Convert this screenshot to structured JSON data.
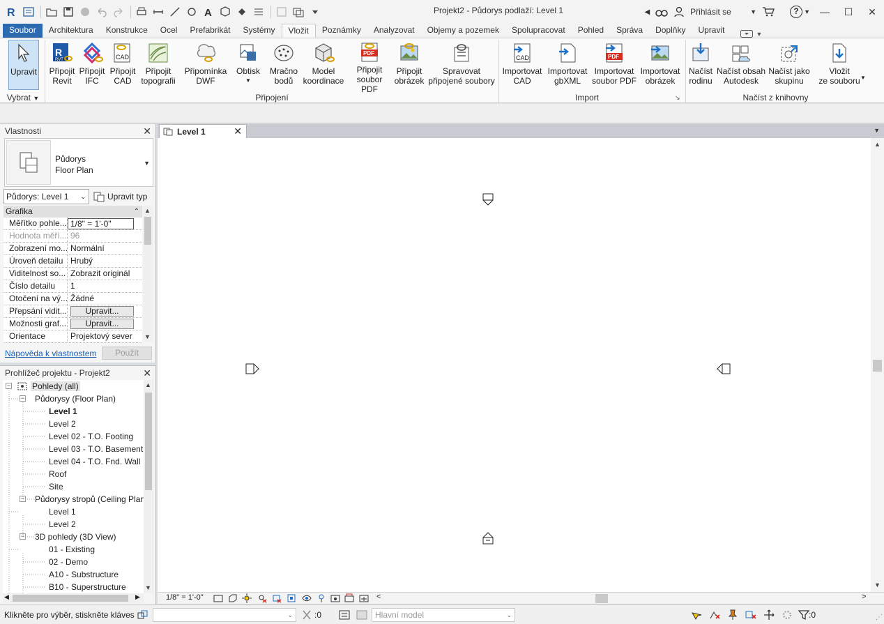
{
  "window": {
    "title": "Projekt2 - Půdorys podlaží: Level 1",
    "sign_in": "Přihlásit se",
    "help": "?"
  },
  "ribbon_tabs": [
    {
      "label": "Soubor"
    },
    {
      "label": "Architektura"
    },
    {
      "label": "Konstrukce"
    },
    {
      "label": "Ocel"
    },
    {
      "label": "Prefabrikát"
    },
    {
      "label": "Systémy"
    },
    {
      "label": "Vložit"
    },
    {
      "label": "Poznámky"
    },
    {
      "label": "Analyzovat"
    },
    {
      "label": "Objemy a pozemek"
    },
    {
      "label": "Spolupracovat"
    },
    {
      "label": "Pohled"
    },
    {
      "label": "Správa"
    },
    {
      "label": "Doplňky"
    },
    {
      "label": "Upravit"
    }
  ],
  "active_tab": "Vložit",
  "ribbon": {
    "select": {
      "label": "Upravit",
      "group": "Vybrat"
    },
    "link_buttons": [
      {
        "line1": "Připojit",
        "line2": "Revit",
        "icon": "link-revit-icon"
      },
      {
        "line1": "Připojit",
        "line2": "IFC",
        "icon": "link-ifc-icon"
      },
      {
        "line1": "Připojit",
        "line2": "CAD",
        "icon": "link-cad-icon"
      },
      {
        "line1": "Připojit",
        "line2": "topografii",
        "icon": "link-topography-icon"
      },
      {
        "line1": "Připomínka",
        "line2": "DWF",
        "icon": "dwf-markup-icon"
      },
      {
        "line1": "Obtisk",
        "line2": "",
        "icon": "decal-icon"
      },
      {
        "line1": "Mračno",
        "line2": "bodů",
        "icon": "point-cloud-icon"
      },
      {
        "line1": "Model",
        "line2": "koordinace",
        "icon": "coordination-model-icon"
      },
      {
        "line1": "Připojit",
        "line2": "soubor PDF",
        "icon": "link-pdf-icon"
      },
      {
        "line1": "Připojit",
        "line2": "obrázek",
        "icon": "link-image-icon"
      },
      {
        "line1": "Spravovat",
        "line2": "připojené soubory",
        "icon": "manage-links-icon"
      }
    ],
    "link_group": "Připojení",
    "import_buttons": [
      {
        "line1": "Importovat",
        "line2": "CAD",
        "icon": "import-cad-icon"
      },
      {
        "line1": "Importovat",
        "line2": "gbXML",
        "icon": "import-gbxml-icon"
      },
      {
        "line1": "Importovat",
        "line2": "soubor PDF",
        "icon": "import-pdf-icon"
      },
      {
        "line1": "Importovat",
        "line2": "obrázek",
        "icon": "import-image-icon"
      }
    ],
    "import_group": "Import",
    "library_buttons": [
      {
        "line1": "Načíst",
        "line2": "rodinu",
        "icon": "load-family-icon"
      },
      {
        "line1": "Načíst obsah",
        "line2": "Autodesk",
        "icon": "load-autodesk-content-icon"
      },
      {
        "line1": "Načíst jako",
        "line2": "skupinu",
        "icon": "load-as-group-icon"
      },
      {
        "line1": "Vložit",
        "line2": "ze souboru",
        "icon": "insert-from-file-icon"
      }
    ],
    "library_group": "Načíst z knihovny"
  },
  "properties": {
    "title": "Vlastnosti",
    "type_line1": "Půdorys",
    "type_line2": "Floor Plan",
    "instance": "Půdorys: Level 1",
    "edit_type": "Upravit typ",
    "section": "Grafika",
    "rows": [
      {
        "name": "Měřítko pohle...",
        "value": "1/8\" = 1'-0\""
      },
      {
        "name": "Hodnota měří...",
        "value": "96"
      },
      {
        "name": "Zobrazení mo...",
        "value": "Normální"
      },
      {
        "name": "Úroveň detailu",
        "value": "Hrubý"
      },
      {
        "name": "Viditelnost so...",
        "value": "Zobrazit originál"
      },
      {
        "name": "Číslo detailu",
        "value": "1"
      },
      {
        "name": "Otočení na vý...",
        "value": "Žádné"
      },
      {
        "name": "Přepsání vidit...",
        "value": "Upravit..."
      },
      {
        "name": "Možnosti graf...",
        "value": "Upravit..."
      },
      {
        "name": "Orientace",
        "value": "Projektový sever"
      }
    ],
    "help_link": "Nápověda k vlastnostem",
    "apply": "Použít"
  },
  "browser": {
    "title": "Prohlížeč projektu - Projekt2",
    "items": [
      {
        "label": "Pohledy (all)",
        "level": 0,
        "toggle": "−"
      },
      {
        "label": "Půdorysy (Floor Plan)",
        "level": 1,
        "toggle": "−"
      },
      {
        "label": "Level 1",
        "level": 2
      },
      {
        "label": "Level 2",
        "level": 2
      },
      {
        "label": "Level 02 - T.O. Footing",
        "level": 2
      },
      {
        "label": "Level 03 - T.O. Basement",
        "level": 2
      },
      {
        "label": "Level 04 - T.O. Fnd. Wall",
        "level": 2
      },
      {
        "label": "Roof",
        "level": 2
      },
      {
        "label": "Site",
        "level": 2
      },
      {
        "label": "Půdorysy stropů (Ceiling Plan",
        "level": 1,
        "toggle": "−"
      },
      {
        "label": "Level 1",
        "level": 2
      },
      {
        "label": "Level 2",
        "level": 2
      },
      {
        "label": "3D pohledy (3D View)",
        "level": 1,
        "toggle": "−"
      },
      {
        "label": "01 - Existing",
        "level": 2
      },
      {
        "label": "02 - Demo",
        "level": 2
      },
      {
        "label": "A10 - Substructure",
        "level": 2
      },
      {
        "label": "B10 - Superstructure",
        "level": 2
      }
    ]
  },
  "view": {
    "tab_label": "Level 1",
    "scale": "1/8\" = 1'-0\""
  },
  "statusbar": {
    "text": "Klikněte pro výběr, stiskněte kláves",
    "zero": ":0",
    "model": "Hlavní model",
    "filter_count": ":0"
  }
}
